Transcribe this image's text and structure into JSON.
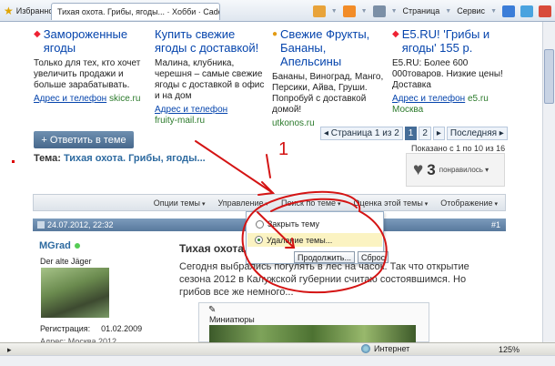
{
  "browser": {
    "favorites_label": "Избранное",
    "tab_title": "Тихая охота. Грибы, ягоды... · Хобби · Caddy Club",
    "tools": [
      "Страница",
      "Сервис"
    ]
  },
  "ads": [
    {
      "title": "Замороженные ягоды",
      "text": "Только для тех, кто хочет увеличить продажи и больше зарабатывать.",
      "link_label": "Адрес и телефон",
      "domain": "skice.ru"
    },
    {
      "title": "Купить свежие ягоды с доставкой!",
      "text": "Малина, клубника, черешня – самые свежие ягоды с доставкой в офис и на дом",
      "link_label": "Адрес и телефон",
      "domain": "fruity-mail.ru"
    },
    {
      "title": "Свежие Фрукты, Бананы, Апельсины",
      "text": "Бананы, Виноград, Манго, Персики, Айва, Груши. Попробуй с доставкой домой!",
      "link_label": "",
      "domain": "utkonos.ru"
    },
    {
      "title": "E5.RU! 'Грибы и ягоды' 155 р.",
      "text": "E5.RU: Более 600 000товаров. Низкие цены! Доставка",
      "link_label": "Адрес и телефон",
      "domain": "e5.ru",
      "extra": "Москва"
    }
  ],
  "reply_button": "+ Ответить в теме",
  "pagination": {
    "label": "◂ Страница 1 из 2",
    "pages": [
      "1",
      "2"
    ],
    "next": "▸",
    "last": "Последняя ▸"
  },
  "shown": "Показано с 1 по 10 из 16",
  "topic": {
    "prefix": "Тема:",
    "title": "Тихая охота. Грибы, ягоды..."
  },
  "likes": {
    "count": "3",
    "label": "понравилось ▾"
  },
  "thread_tools": [
    "Опции темы",
    "Управление",
    "Поиск по теме",
    "Оценка этой темы",
    "Отображение"
  ],
  "dropdown": {
    "option1": "Закрыть тему",
    "option2": "Удаление темы...",
    "buttons": [
      "Продолжить...",
      "Сброс"
    ]
  },
  "post": {
    "date": "24.07.2012, 22:32",
    "number": "#1",
    "username": "MGrad",
    "usertitle": "Der alte Jäger",
    "reg_label": "Регистрация:",
    "reg_date": "01.02.2009",
    "reg_more": "Адрес:    Москва 2012",
    "title": "Тихая охота. Г",
    "body": "Сегодня выбрались погулять в лес на часок. Так что открытие сезона 2012 в Калужской губернии считаю состоявшимся. Но грибов все же немного...",
    "attach_label": "Миниатюры"
  },
  "annotation": {
    "number": "1"
  },
  "status": {
    "zone": "Интернет",
    "zoom": "125%"
  },
  "colors": {
    "accent": "#456d98",
    "annotation": "#d41414"
  }
}
